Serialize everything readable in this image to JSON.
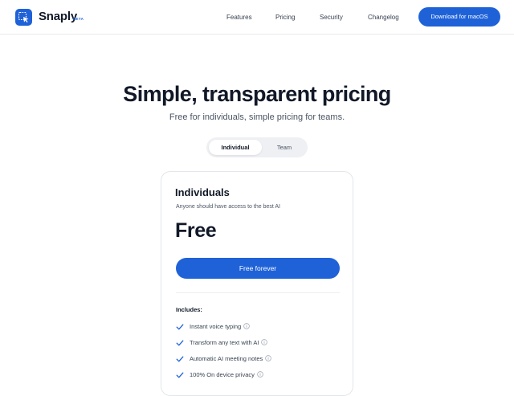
{
  "brand": {
    "name": "Snaply",
    "badge": "BETA",
    "logo_icon": "cursor-select-icon",
    "accent_color": "#1f62d8"
  },
  "nav": {
    "links": [
      "Features",
      "Pricing",
      "Security",
      "Changelog"
    ],
    "cta_label": "Download for macOS"
  },
  "hero": {
    "title": "Simple, transparent pricing",
    "subtitle": "Free for individuals, simple pricing for teams."
  },
  "plan_toggle": {
    "options": [
      "Individual",
      "Team"
    ],
    "selected": "Individual"
  },
  "plan_card": {
    "name": "Individuals",
    "description": "Anyone should have access to the best AI",
    "price": "Free",
    "cta_label": "Free forever",
    "includes_label": "Includes:",
    "features": [
      {
        "label": "Instant voice typing",
        "icon": "check-icon",
        "info_icon": "info-icon"
      },
      {
        "label": "Transform any text with AI",
        "icon": "check-icon",
        "info_icon": "info-icon"
      },
      {
        "label": "Automatic AI meeting notes",
        "icon": "check-icon",
        "info_icon": "info-icon"
      },
      {
        "label": "100% On device privacy",
        "icon": "check-icon",
        "info_icon": "info-icon"
      }
    ]
  }
}
